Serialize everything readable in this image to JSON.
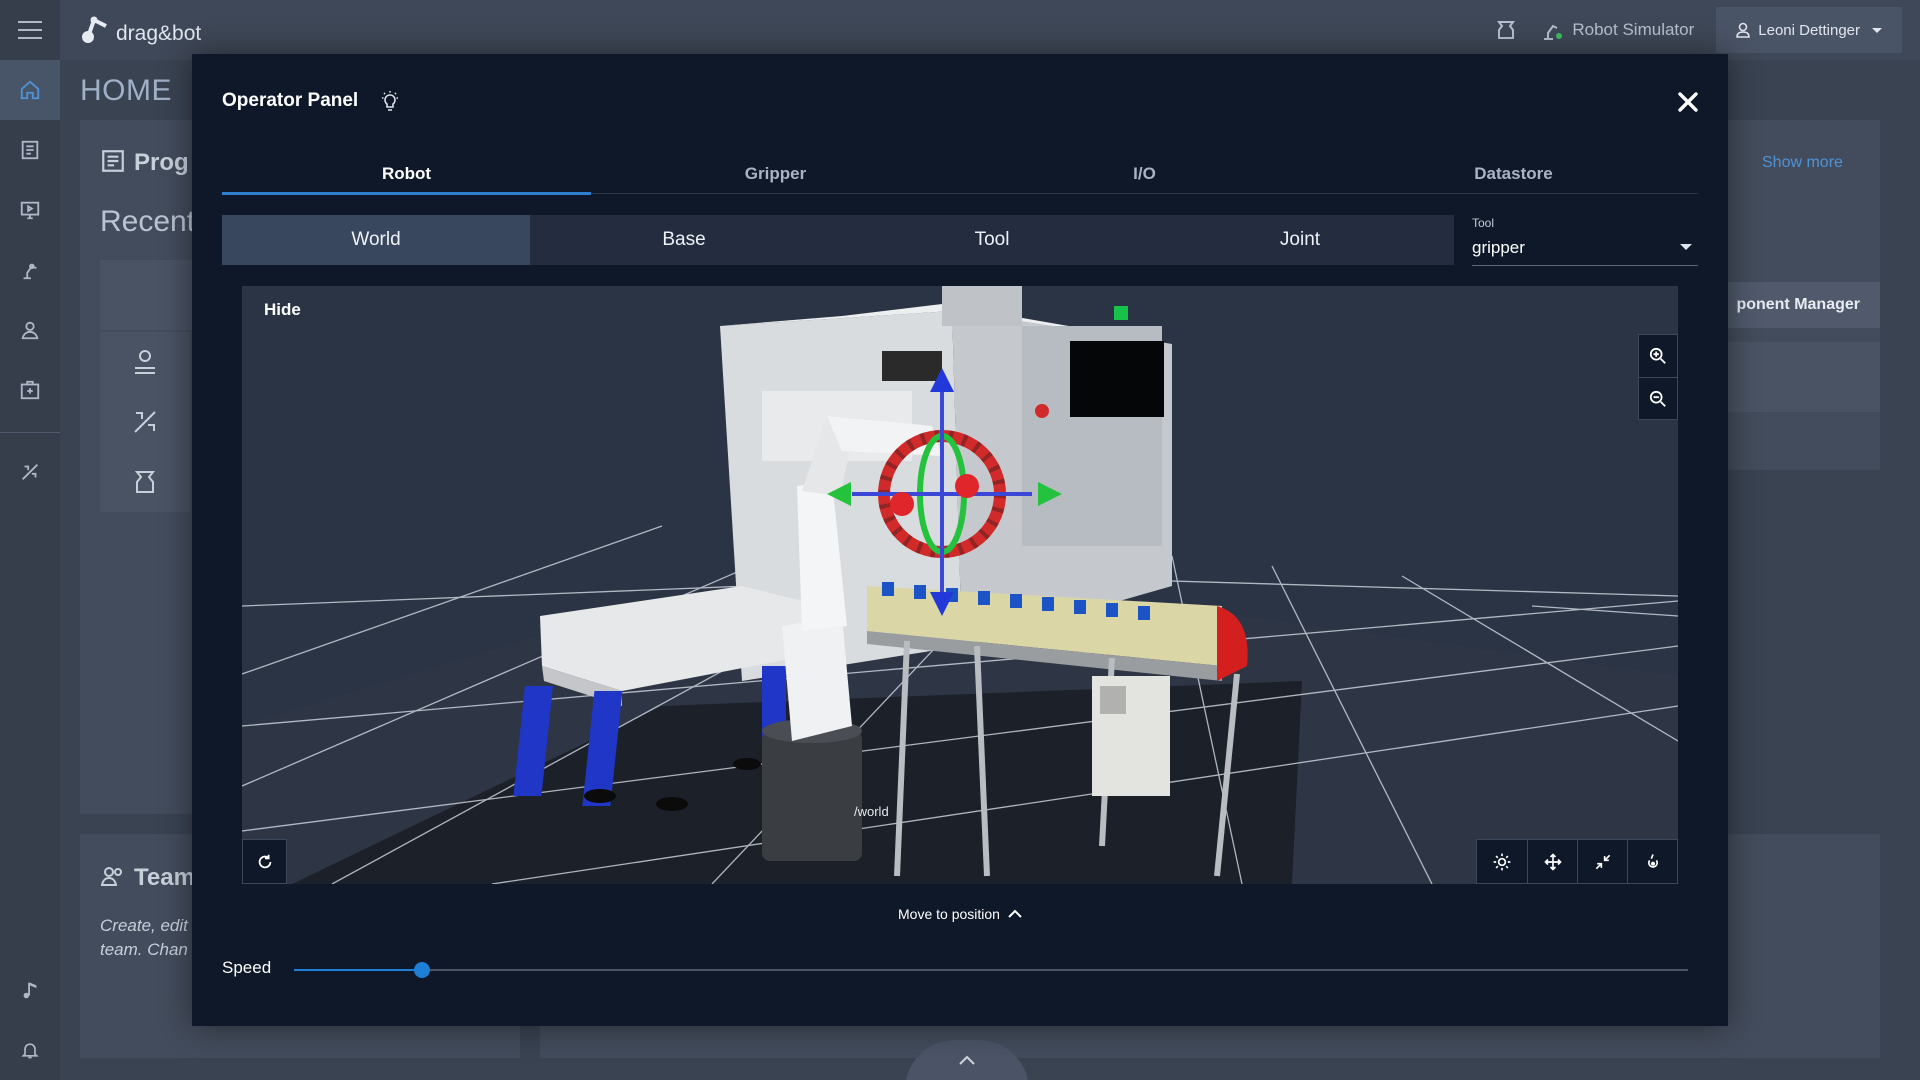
{
  "app": {
    "brand": "drag&bot",
    "page_title": "HOME"
  },
  "topbar": {
    "simulator_label": "Robot Simulator",
    "user_name": "Leoni Dettinger"
  },
  "background": {
    "programs_title": "Prog",
    "recent_label": "Recent",
    "show_more": "Show more",
    "component_manager": "ponent Manager",
    "team_title": "Team",
    "team_desc_1": "Create, edit",
    "team_desc_2": "team. Chan"
  },
  "modal": {
    "title": "Operator Panel",
    "tabs": [
      {
        "label": "Robot",
        "active": true
      },
      {
        "label": "Gripper",
        "active": false
      },
      {
        "label": "I/O",
        "active": false
      },
      {
        "label": "Datastore",
        "active": false
      }
    ],
    "frames": [
      {
        "label": "World",
        "active": true
      },
      {
        "label": "Base",
        "active": false
      },
      {
        "label": "Tool",
        "active": false
      },
      {
        "label": "Joint",
        "active": false
      }
    ],
    "tool": {
      "label": "Tool",
      "value": "gripper"
    },
    "viewport": {
      "hide_label": "Hide",
      "world_label": "/world"
    },
    "move_to_position": "Move to position",
    "speed": {
      "label": "Speed",
      "value_fraction": 0.092
    }
  },
  "colors": {
    "accent": "#1e7fd6",
    "modal_bg": "#0f1829",
    "app_bg": "#3a4352"
  }
}
